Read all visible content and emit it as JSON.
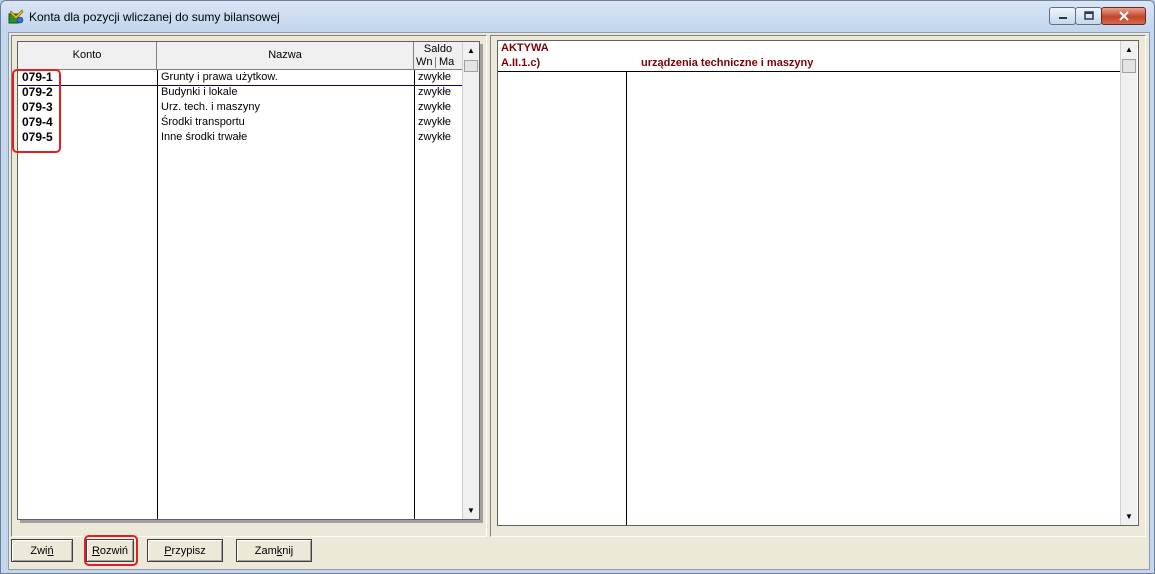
{
  "window": {
    "title": "Konta dla pozycji wliczanej do sumy bilansowej"
  },
  "left_table": {
    "headers": {
      "konto": "Konto",
      "nazwa": "Nazwa",
      "saldo": "Saldo",
      "saldo_wn": "Wn",
      "saldo_ma": "Ma"
    },
    "rows": [
      {
        "konto": "079-1",
        "nazwa": "Grunty i prawa użytkow.",
        "saldo": "zwykłe"
      },
      {
        "konto": "079-2",
        "nazwa": "Budynki i lokale",
        "saldo": "zwykłe"
      },
      {
        "konto": "079-3",
        "nazwa": "Urz. tech. i maszyny",
        "saldo": "zwykłe"
      },
      {
        "konto": "079-4",
        "nazwa": "Środki transportu",
        "saldo": "zwykłe"
      },
      {
        "konto": "079-5",
        "nazwa": "Inne środki trwałe",
        "saldo": "zwykłe"
      }
    ]
  },
  "right_table": {
    "section": "AKTYWA",
    "code": "A.II.1.c)",
    "description": "urządzenia techniczne i maszyny"
  },
  "buttons": {
    "collapse": {
      "pre": "Zwi",
      "key": "ń",
      "post": ""
    },
    "expand": {
      "pre": "",
      "key": "R",
      "post": "ozwiń"
    },
    "assign": {
      "pre": "",
      "key": "P",
      "post": "rzypisz"
    },
    "close": {
      "pre": "Zam",
      "key": "k",
      "post": "nij"
    }
  },
  "colors": {
    "accent_red": "#800000",
    "highlight_red": "#e02020"
  }
}
